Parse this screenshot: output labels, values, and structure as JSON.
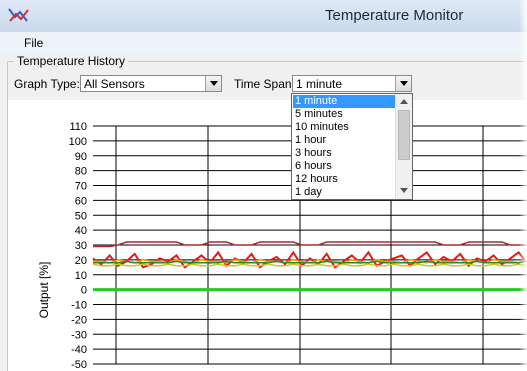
{
  "window": {
    "title": "Temperature Monitor"
  },
  "menu": {
    "file": "File"
  },
  "group": {
    "label": "Temperature History"
  },
  "controls": {
    "graph_type_label": "Graph Type:",
    "graph_type_value": "All Sensors",
    "time_span_label": "Time Span:",
    "time_span_value": "1 minute"
  },
  "time_span_options": [
    "1 minute",
    "5 minutes",
    "10 minutes",
    "1 hour",
    "3 hours",
    "6 hours",
    "12 hours",
    "1 day"
  ],
  "selected_option": "1 minute",
  "chart_data": {
    "type": "line",
    "ylabel": "Output [%]",
    "ylim": [
      -50,
      110
    ],
    "yticks": [
      "110",
      "100",
      "90",
      "80",
      "70",
      "60",
      "50",
      "40",
      "30",
      "20",
      "10",
      "0",
      "-10",
      "-20",
      "-30",
      "-40",
      "-50"
    ],
    "grid": true,
    "series": [
      {
        "color": "#a03030",
        "values": [
          29,
          29,
          29,
          30,
          32,
          32,
          32,
          32,
          32,
          32,
          32,
          30,
          30,
          30,
          32,
          32,
          32,
          30,
          30,
          30,
          32,
          32,
          32,
          32,
          32,
          30,
          30,
          30,
          32,
          32,
          32,
          32,
          32,
          32,
          32,
          32,
          32,
          32,
          32,
          32,
          32,
          32,
          30,
          30,
          30,
          32,
          32,
          32,
          32,
          32,
          30,
          30,
          30
        ]
      },
      {
        "color": "#e81a1a",
        "values": [
          21,
          17,
          23,
          16,
          19,
          24,
          15,
          17,
          21,
          19,
          23,
          15,
          19,
          23,
          18,
          25,
          16,
          21,
          18,
          24,
          15,
          19,
          22,
          17,
          25,
          16,
          21,
          17,
          24,
          15,
          19,
          23,
          18,
          25,
          16,
          19,
          21,
          23,
          16,
          21,
          25,
          17,
          22,
          19,
          24,
          16,
          21,
          19,
          23,
          17,
          21,
          25,
          18
        ]
      },
      {
        "color": "#f0a020",
        "values": [
          19,
          19,
          18,
          20,
          19,
          18,
          20,
          19,
          19,
          18,
          20,
          19,
          18,
          20,
          19,
          19,
          18,
          20,
          19,
          18,
          20,
          19,
          19,
          18,
          20,
          19,
          18,
          20,
          19,
          19,
          18,
          20,
          19,
          18,
          20,
          19,
          19,
          18,
          20,
          19,
          18,
          20,
          19,
          19,
          18,
          20,
          19,
          18,
          20,
          19,
          19,
          18,
          20
        ]
      },
      {
        "color": "#c8c820",
        "values": [
          17,
          16,
          16,
          17,
          16,
          16,
          17,
          16,
          16,
          17,
          16,
          16,
          17,
          16,
          16,
          17,
          16,
          16,
          17,
          16,
          16,
          17,
          16,
          16,
          17,
          16,
          16,
          17,
          16,
          16,
          17,
          16,
          16,
          17,
          16,
          16,
          17,
          16,
          16,
          17,
          16,
          16,
          17,
          16,
          16,
          17,
          16,
          16,
          17,
          16,
          16,
          17,
          16
        ]
      },
      {
        "color": "#2a8a2a",
        "values": [
          18,
          18,
          18,
          18,
          19,
          18,
          18,
          18,
          18,
          18,
          19,
          18,
          18,
          18,
          18,
          18,
          19,
          18,
          18,
          18,
          18,
          18,
          19,
          18,
          18,
          18,
          18,
          18,
          19,
          18,
          18,
          18,
          18,
          18,
          19,
          18,
          18,
          18,
          18,
          18,
          19,
          18,
          18,
          18,
          18,
          18,
          19,
          18,
          18,
          18,
          18,
          18,
          19
        ]
      },
      {
        "color": "#22cc22",
        "values": [
          0,
          0,
          0,
          0,
          0,
          0,
          0,
          0,
          0,
          0,
          0,
          0,
          0,
          0,
          0,
          0,
          0,
          0,
          0,
          0,
          0,
          0,
          0,
          0,
          0,
          0,
          0,
          0,
          0,
          0,
          0,
          0,
          0,
          0,
          0,
          0,
          0,
          0,
          0,
          0,
          0,
          0,
          0,
          0,
          0,
          0,
          0,
          0,
          0,
          0,
          0,
          0,
          0
        ]
      }
    ]
  }
}
